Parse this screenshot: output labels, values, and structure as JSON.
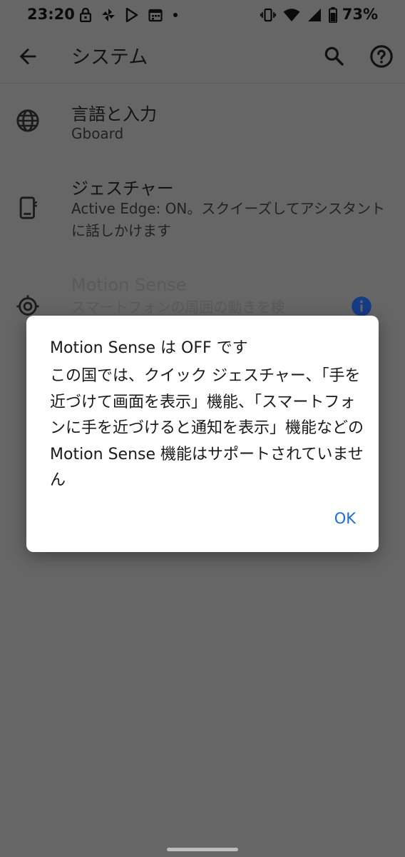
{
  "status_bar": {
    "time": "23:20",
    "battery": "73%",
    "left_icons": [
      "lock-icon",
      "pinwheel-icon",
      "play-store-icon",
      "calendar-icon",
      "dot-icon"
    ],
    "right_icons": [
      "vibrate-icon",
      "wifi-icon",
      "signal-icon",
      "battery-icon"
    ]
  },
  "app_bar": {
    "title": "システム",
    "back_icon": "arrow-back-icon",
    "search_icon": "search-icon",
    "help_icon": "help-icon"
  },
  "list": {
    "items": [
      {
        "title": "言語と入力",
        "subtitle": "Gboard",
        "icon": "globe-icon"
      },
      {
        "title": "ジェスチャー",
        "subtitle": "Active Edge: ON。スクイーズしてアシスタントに話しかけます",
        "icon": "phone-gesture-icon"
      },
      {
        "title": "Motion Sense",
        "subtitle": "スマートフォンの周囲の動きを検",
        "icon": "motion-sense-icon",
        "trailing_icon": "info-icon"
      }
    ]
  },
  "dialog": {
    "title": "Motion Sense は OFF です",
    "body": "この国では、クイック ジェスチャー、「手を近づけて画面を表示」機能、「スマートフォンに手を近づけると通知を表示」機能などの Motion Sense 機能はサポートされていません",
    "ok_label": "OK"
  },
  "colors": {
    "scrim": "#666666",
    "dialog_bg": "#ffffff",
    "accent": "#1a6fd4"
  }
}
